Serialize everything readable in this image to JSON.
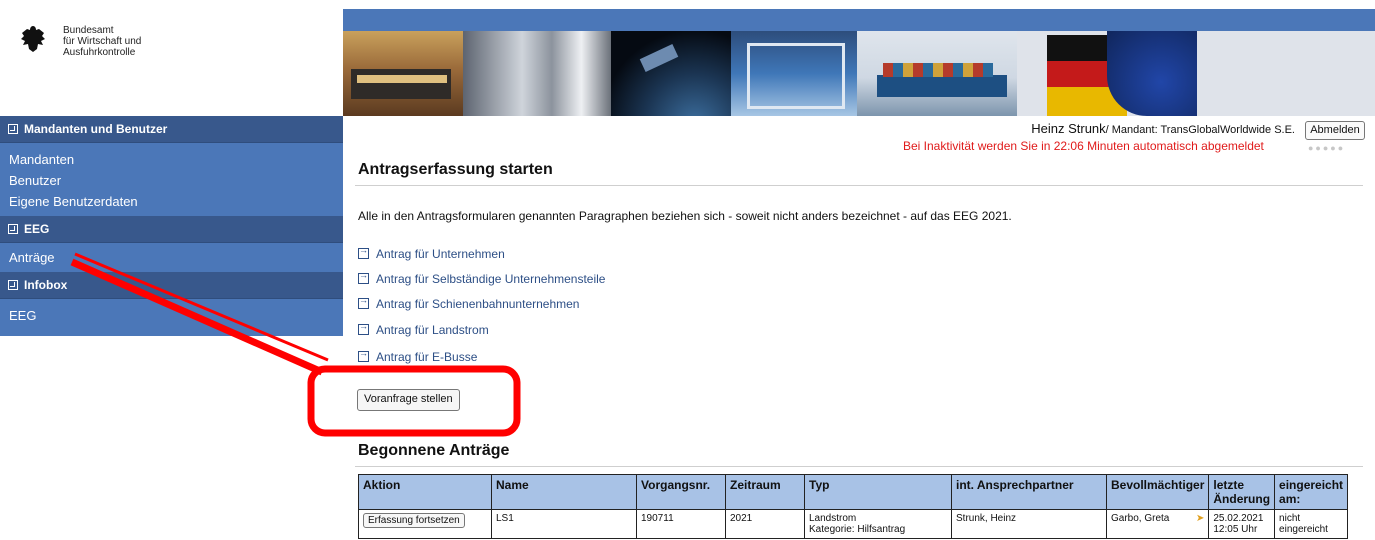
{
  "logo": {
    "line1": "Bundesamt",
    "line2": "für Wirtschaft und",
    "line3": "Ausfuhrkontrolle"
  },
  "sidebar": {
    "sections": [
      {
        "title": "Mandanten und Benutzer",
        "items": [
          "Mandanten",
          "Benutzer",
          "Eigene Benutzerdaten"
        ]
      },
      {
        "title": "EEG",
        "items": [
          "Anträge"
        ]
      },
      {
        "title": "Infobox",
        "items": [
          "EEG"
        ]
      }
    ]
  },
  "user": {
    "name": "Heinz Strunk",
    "mandant": "/ Mandant: TransGlobalWorldwide S.E.",
    "logout": "Abmelden",
    "timeout": "Bei Inaktivität werden Sie in 22:06 Minuten automatisch abgemeldet",
    "dots": "●●●●●"
  },
  "main": {
    "title": "Antragserfassung starten",
    "intro": "Alle in den Antragsformularen genannten Paragraphen beziehen sich - soweit nicht anders bezeichnet - auf das EEG 2021.",
    "links": [
      "Antrag für Unternehmen",
      "Antrag für Selbständige Unternehmensteile",
      "Antrag für Schienenbahnunternehmen",
      "Antrag für Landstrom",
      "Antrag für E-Busse"
    ],
    "voranfrage_button": "Voranfrage stellen",
    "started_title": "Begonnene Anträge"
  },
  "table": {
    "headers": [
      "Aktion",
      "Name",
      "Vorgangsnr.",
      "Zeitraum",
      "Typ",
      "int. Ansprechpartner",
      "Bevollmächtiger",
      "letzte Änderung",
      "eingereicht am:"
    ],
    "rows": [
      {
        "action": "Erfassung fortsetzen",
        "name": "LS1",
        "vorgangsnr": "190711",
        "zeitraum": "2021",
        "typ": "Landstrom",
        "typ_sub": "Kategorie: Hilfsantrag",
        "ansprechpartner": "Strunk, Heinz",
        "bevollmaechtigter": "Garbo, Greta",
        "letzte_aenderung": "25.02.2021",
        "letzte_aenderung_time": "12:05 Uhr",
        "eingereicht": "nicht eingereicht"
      }
    ]
  },
  "colors": {
    "brand_blue": "#4b77b8",
    "sidebar_header": "#38588c",
    "table_header": "#a8c2e6",
    "warning_red": "#e01b1b",
    "annotation_red": "#ff0000"
  }
}
